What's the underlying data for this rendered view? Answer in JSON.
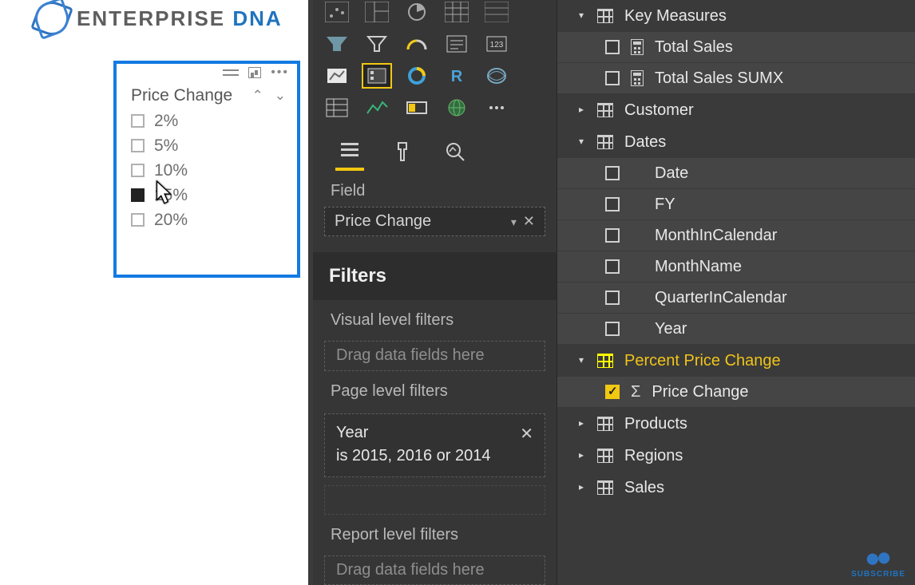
{
  "logo": {
    "text1": "ENTERPRISE ",
    "text2": "DNA"
  },
  "slicer": {
    "title": "Price Change",
    "items": [
      {
        "label": "2%",
        "checked": false
      },
      {
        "label": "5%",
        "checked": false
      },
      {
        "label": "10%",
        "checked": false
      },
      {
        "label": "15%",
        "checked": true
      },
      {
        "label": "20%",
        "checked": false
      }
    ]
  },
  "vizpane": {
    "field_section": "Field",
    "field_value": "Price Change",
    "filters_header": "Filters",
    "visual_filters_lbl": "Visual level filters",
    "visual_filters_placeholder": "Drag data fields here",
    "page_filters_lbl": "Page level filters",
    "page_filter_field": "Year",
    "page_filter_summary": "is 2015, 2016 or 2014",
    "report_filters_lbl": "Report level filters",
    "report_filters_placeholder": "Drag data fields here"
  },
  "fields": {
    "key_measures": {
      "label": "Key Measures",
      "children": [
        {
          "label": "Total Sales"
        },
        {
          "label": "Total Sales SUMX"
        }
      ]
    },
    "customer": {
      "label": "Customer"
    },
    "dates": {
      "label": "Dates",
      "children": [
        {
          "label": "Date"
        },
        {
          "label": "FY"
        },
        {
          "label": "MonthInCalendar"
        },
        {
          "label": "MonthName"
        },
        {
          "label": "QuarterInCalendar"
        },
        {
          "label": "Year"
        }
      ]
    },
    "ppc": {
      "label": "Percent Price Change",
      "children": [
        {
          "label": "Price Change",
          "checked": true
        }
      ]
    },
    "products": {
      "label": "Products"
    },
    "regions": {
      "label": "Regions"
    },
    "sales": {
      "label": "Sales"
    }
  },
  "subscribe": "SUBSCRIBE"
}
